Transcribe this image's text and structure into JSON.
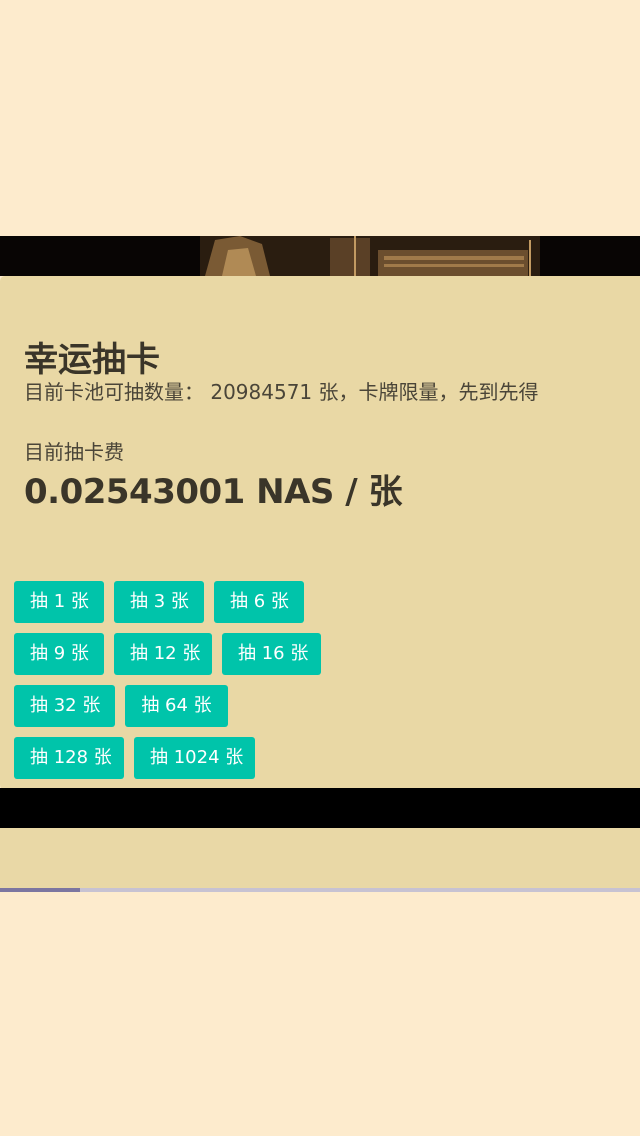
{
  "card": {
    "title": "幸运抽卡",
    "pool_line": "目前卡池可抽数量： 20984571 张，卡牌限量，先到先得",
    "fee_label": "目前抽卡费",
    "fee_value": "0.02543001 NAS / 张"
  },
  "buttons": {
    "row1": [
      "抽 1 张",
      "抽 3 张",
      "抽 6 张"
    ],
    "row2": [
      "抽 9 张",
      "抽 12 张",
      "抽 16 张"
    ],
    "row3": [
      "抽 32 张",
      "抽 64 张"
    ],
    "row4": [
      "抽 128 张",
      "抽 1024 张"
    ]
  },
  "colors": {
    "page_background": "#fdebcd",
    "panel_background": "#e9d8a5",
    "button_background": "#00c4aa",
    "button_text": "#ffffff",
    "text_dark": "#3a3529"
  }
}
